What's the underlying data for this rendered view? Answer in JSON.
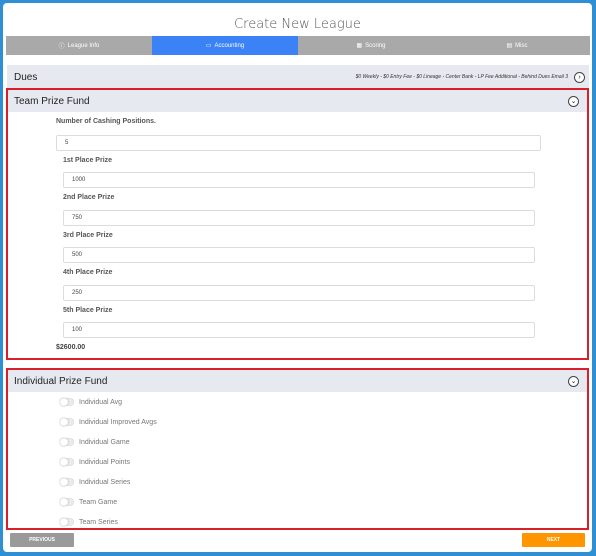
{
  "page": {
    "title": "Create New League"
  },
  "tabs": [
    {
      "label": "League Info",
      "icon": "info-icon"
    },
    {
      "label": "Accounting",
      "icon": "money-icon"
    },
    {
      "label": "Scoring",
      "icon": "calendar-icon"
    },
    {
      "label": "Misc",
      "icon": "document-icon"
    }
  ],
  "dues": {
    "title": "Dues",
    "summary": "$0 Weekly - $0 Entry Fee - $0 Lineage - Center Bank - LP Fee Additional - Behind Dues Email 3"
  },
  "team_prize": {
    "title": "Team Prize Fund",
    "cashing_label": "Number of Cashing Positions.",
    "cashing_value": "5",
    "places": [
      {
        "label": "1st Place Prize",
        "value": "1000"
      },
      {
        "label": "2nd Place Prize",
        "value": "750"
      },
      {
        "label": "3rd Place Prize",
        "value": "500"
      },
      {
        "label": "4th Place Prize",
        "value": "250"
      },
      {
        "label": "5th Place Prize",
        "value": "100"
      }
    ],
    "total": "$2600.00"
  },
  "individual_prize": {
    "title": "Individual Prize Fund",
    "toggles": [
      {
        "label": "Individual Avg",
        "on": false
      },
      {
        "label": "Individual Improved Avgs",
        "on": false
      },
      {
        "label": "Individual Game",
        "on": false
      },
      {
        "label": "Individual Points",
        "on": false
      },
      {
        "label": "Individual Series",
        "on": false
      },
      {
        "label": "Team Game",
        "on": false
      },
      {
        "label": "Team Series",
        "on": false
      }
    ]
  },
  "footer": {
    "previous_label": "PREVIOUS",
    "next_label": "NEXT"
  },
  "colors": {
    "accent": "#3b82f6",
    "next": "#ff9500",
    "highlight": "#d7202a",
    "background": "#2f8fd4"
  }
}
